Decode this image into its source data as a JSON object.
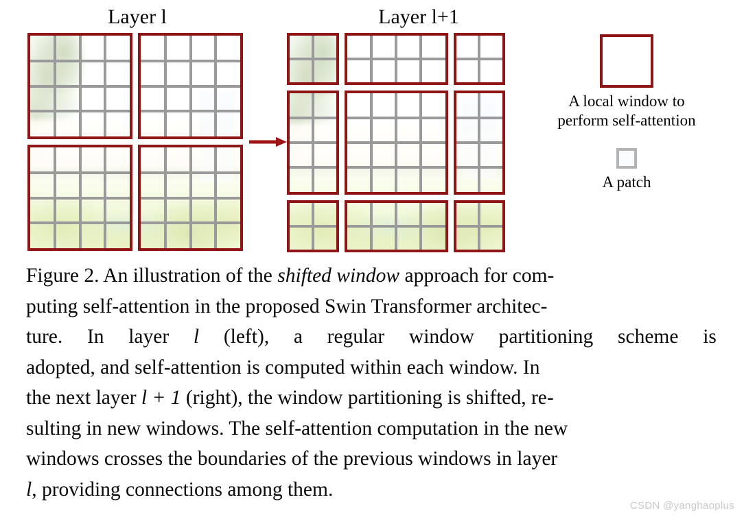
{
  "figure": {
    "left_panel_title": "Layer l",
    "right_panel_title": "Layer l+1",
    "arrow_name": "right-arrow"
  },
  "legend": {
    "window_swatch_name": "local-window-swatch",
    "window_label_line1": "A local window to",
    "window_label_line2": "perform self-attention",
    "patch_swatch_name": "patch-swatch",
    "patch_label": "A patch"
  },
  "caption": {
    "line1_a": "Figure 2. An illustration of the ",
    "line1_italic": "shifted window",
    "line1_b": " approach for com-",
    "line2": "puting self-attention in the proposed Swin Transformer architec-",
    "line3_a": "ture.",
    "line3_b": "In",
    "line3_c": "layer",
    "line3_math": "l",
    "line3_d": "(left),",
    "line3_e": "a",
    "line3_f": "regular",
    "line3_g": "window",
    "line3_h": "partitioning",
    "line3_i": "scheme",
    "line3_j": "is",
    "line4": "adopted, and self-attention is computed within each window.  In",
    "line5_a": "the next layer ",
    "line5_math": "l + 1",
    "line5_b": " (right), the window partitioning is shifted, re-",
    "line6": "sulting in new windows. The self-attention computation in the new",
    "line7": "windows crosses the boundaries of the previous windows in layer",
    "line8_math": "l",
    "line8_b": ", providing connections among them."
  },
  "watermark": {
    "text": "CSDN @yanghaoplus"
  },
  "colors": {
    "window_border": "#8e1616",
    "patch_grid": "#9a9a9a",
    "patch_border": "#b4b4b4",
    "arrow": "#9e1414",
    "text": "#000000",
    "watermark": "#c9c9c9",
    "background": "#ffffff"
  },
  "chart_data": {
    "type": "diagram",
    "title": "Shifted window partitioning (Swin Transformer)",
    "patch_grid": {
      "rows": 8,
      "cols": 8
    },
    "layers": [
      {
        "name": "Layer l",
        "window_count": 4,
        "window_size_patches": [
          4,
          4
        ],
        "row_splits_patches": [
          4,
          4
        ],
        "col_splits_patches": [
          4,
          4
        ],
        "windows": [
          {
            "row": 0,
            "col": 0,
            "patch_rows": 4,
            "patch_cols": 4
          },
          {
            "row": 0,
            "col": 1,
            "patch_rows": 4,
            "patch_cols": 4
          },
          {
            "row": 1,
            "col": 0,
            "patch_rows": 4,
            "patch_cols": 4
          },
          {
            "row": 1,
            "col": 1,
            "patch_rows": 4,
            "patch_cols": 4
          }
        ]
      },
      {
        "name": "Layer l+1",
        "window_count": 9,
        "shift_patches": [
          2,
          2
        ],
        "row_splits_patches": [
          2,
          4,
          2
        ],
        "col_splits_patches": [
          2,
          4,
          2
        ],
        "windows": [
          {
            "row": 0,
            "col": 0,
            "patch_rows": 2,
            "patch_cols": 2
          },
          {
            "row": 0,
            "col": 1,
            "patch_rows": 2,
            "patch_cols": 4
          },
          {
            "row": 0,
            "col": 2,
            "patch_rows": 2,
            "patch_cols": 2
          },
          {
            "row": 1,
            "col": 0,
            "patch_rows": 4,
            "patch_cols": 2
          },
          {
            "row": 1,
            "col": 1,
            "patch_rows": 4,
            "patch_cols": 4
          },
          {
            "row": 1,
            "col": 2,
            "patch_rows": 4,
            "patch_cols": 2
          },
          {
            "row": 2,
            "col": 0,
            "patch_rows": 2,
            "patch_cols": 2
          },
          {
            "row": 2,
            "col": 1,
            "patch_rows": 2,
            "patch_cols": 4
          },
          {
            "row": 2,
            "col": 2,
            "patch_rows": 2,
            "patch_cols": 2
          }
        ]
      }
    ]
  }
}
